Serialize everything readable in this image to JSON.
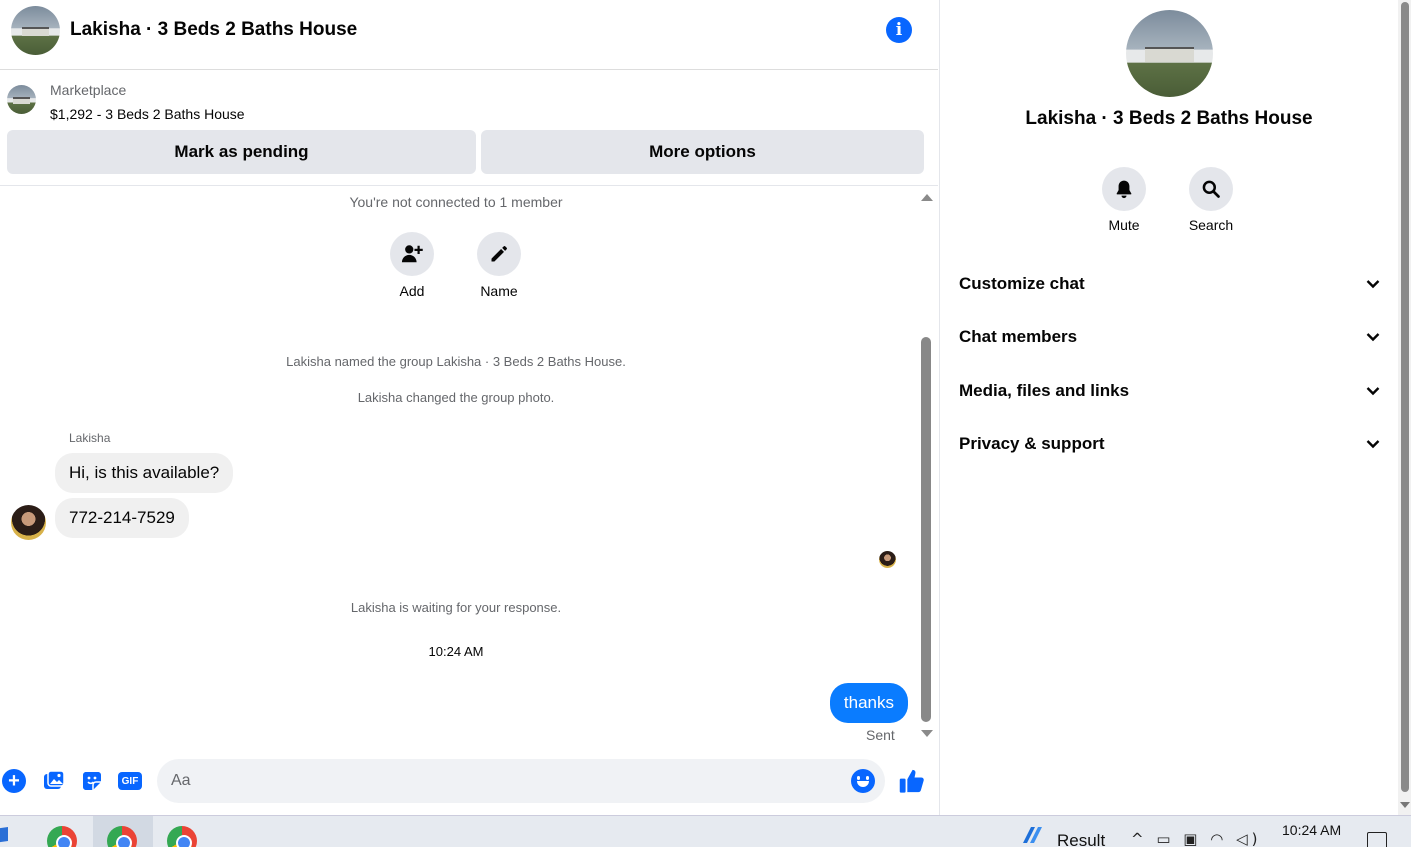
{
  "header": {
    "title": "Lakisha · 3 Beds 2 Baths House"
  },
  "listing": {
    "source": "Marketplace",
    "price_title": "$1,292 - 3 Beds 2 Baths House",
    "mark_pending_label": "Mark as pending",
    "more_options_label": "More options"
  },
  "thread": {
    "not_connected": "You're not connected to 1 member",
    "add_label": "Add",
    "name_label": "Name",
    "named_event": "Lakisha named the group Lakisha · 3 Beds 2 Baths House.",
    "photo_event": "Lakisha changed the group photo.",
    "sender": "Lakisha",
    "messages_in": [
      "Hi, is this available?",
      "772-214-7529"
    ],
    "waiting": "Lakisha is waiting for your response.",
    "timestamp": "10:24 AM",
    "message_out": "thanks",
    "sent_status": "Sent"
  },
  "composer": {
    "placeholder": "Aa",
    "gif_label": "GIF"
  },
  "info_pane": {
    "title": "Lakisha · 3 Beds 2 Baths House",
    "mute_label": "Mute",
    "search_label": "Search",
    "sections": [
      "Customize chat",
      "Chat members",
      "Media, files and links",
      "Privacy & support"
    ]
  },
  "taskbar": {
    "weather_label": "Result",
    "time": "10:24 AM"
  },
  "colors": {
    "accent": "#0866ff",
    "outgoing_bubble": "#0a7cff",
    "incoming_bubble": "#f0f0f0",
    "button_gray": "#e4e6eb"
  },
  "icons": [
    "info-icon",
    "add-person-icon",
    "pencil-icon",
    "plus-icon",
    "photo-icon",
    "sticker-icon",
    "gif-icon",
    "emoji-icon",
    "thumbs-up-icon",
    "bell-icon",
    "search-icon",
    "chevron-down-icon",
    "chrome-icon",
    "weather-icon",
    "notification-icon"
  ]
}
